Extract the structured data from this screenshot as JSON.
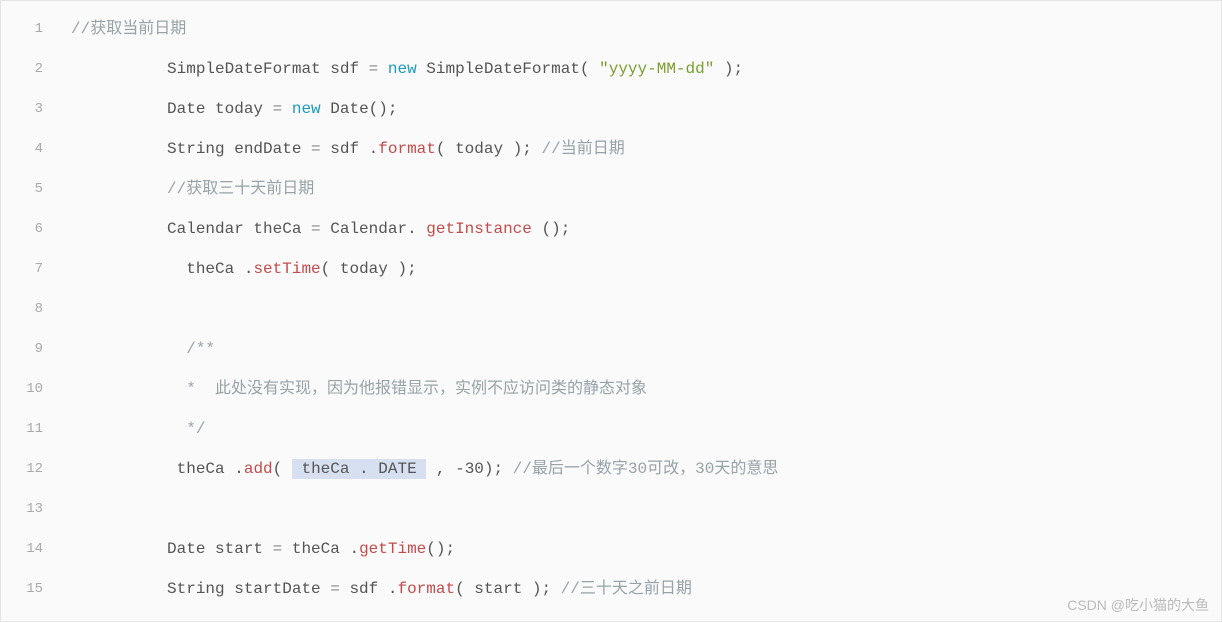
{
  "lines": [
    "1",
    "2",
    "3",
    "4",
    "5",
    "6",
    "7",
    "8",
    "9",
    "10",
    "11",
    "12",
    "13",
    "14",
    "15"
  ],
  "code": {
    "l1": {
      "comment": "//获取当前日期"
    },
    "l2": {
      "indent": "          ",
      "t1": "SimpleDateFormat sdf ",
      "eq": "= ",
      "kw": "new",
      "t2": " SimpleDateFormat( ",
      "str": "\"yyyy-MM-dd\"",
      "t3": " );"
    },
    "l3": {
      "indent": "          ",
      "t1": "Date today ",
      "eq": "= ",
      "kw": "new",
      "t2": " Date();"
    },
    "l4": {
      "indent": "          ",
      "t1": "String endDate ",
      "eq": "= ",
      "t2": "sdf .",
      "call": "format",
      "t3": "( today ); ",
      "comment": "//当前日期"
    },
    "l5": {
      "indent": "          ",
      "comment": "//获取三十天前日期"
    },
    "l6": {
      "indent": "          ",
      "t1": "Calendar theCa ",
      "eq": "= ",
      "t2": "Calendar. ",
      "call": "getInstance",
      "t3": " ();"
    },
    "l7": {
      "indent": "            ",
      "t1": "theCa .",
      "call": "setTime",
      "t2": "( today );"
    },
    "l8": {
      "indent": ""
    },
    "l9": {
      "indent": "            ",
      "comment": "/**"
    },
    "l10": {
      "indent": "            ",
      "star": "* ",
      "comment": " 此处没有实现，因为他报错显示，实例不应访问类的静态对象"
    },
    "l11": {
      "indent": "            ",
      "comment": "*/"
    },
    "l12": {
      "indent": "           ",
      "t1": "theCa .",
      "call": "add",
      "t2": "( ",
      "hl": " theCa . DATE ",
      "t3": " , ",
      "num": "-30",
      "t4": "); ",
      "comment": "//最后一个数字30可改，30天的意思"
    },
    "l13": {
      "indent": ""
    },
    "l14": {
      "indent": "          ",
      "t1": "Date start ",
      "eq": "= ",
      "t2": "theCa .",
      "call": "getTime",
      "t3": "();"
    },
    "l15": {
      "indent": "          ",
      "t1": "String startDate ",
      "eq": "= ",
      "t2": "sdf .",
      "call": "format",
      "t3": "( start ); ",
      "comment": "//三十天之前日期"
    }
  },
  "watermark": "CSDN @吃小猫的大鱼"
}
